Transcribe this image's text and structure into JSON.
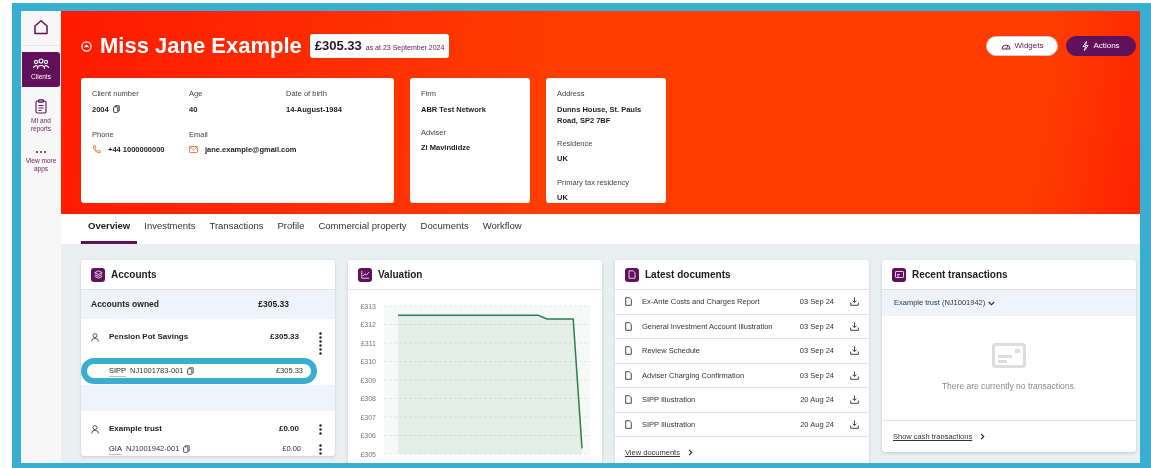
{
  "sidebar": {
    "items": [
      {
        "kind": "home",
        "selected": false
      },
      {
        "kind": "people",
        "label": "Clients",
        "selected": true
      },
      {
        "kind": "clipboard",
        "label": "MI and reports",
        "selected": false
      },
      {
        "kind": "more",
        "label": "View more apps",
        "selected": false
      }
    ]
  },
  "header": {
    "client_name": "Miss Jane Example",
    "balance": "£305.33",
    "as_at": "as at 23 September 2024",
    "buttons": [
      {
        "kind": "widgets",
        "label": "Widgets"
      },
      {
        "kind": "actions",
        "label": "Actions"
      }
    ],
    "cards": [
      {
        "fields": [
          {
            "label": "Client number",
            "value": "2004",
            "kind": "copyable"
          },
          {
            "label": "Age",
            "value": "40"
          },
          {
            "label": "Date of birth",
            "value": "14-August-1984"
          },
          {
            "label": "Phone",
            "value": "+44 1000000000",
            "kind": "phone"
          },
          {
            "label": "Email",
            "value": "jane.example@gmail.com",
            "kind": "email"
          }
        ]
      },
      {
        "fields": [
          {
            "label": "Firm",
            "value": "ABR Test Network"
          },
          {
            "label": "Adviser",
            "value": "Zi Mavindidze"
          }
        ]
      },
      {
        "fields": [
          {
            "label": "Address",
            "value": "Dunns House, St. Pauls Road, SP2 7BF"
          },
          {
            "label": "Residence",
            "value": "UK"
          },
          {
            "label": "Primary tax residency",
            "value": "UK"
          }
        ]
      }
    ]
  },
  "tabs": [
    {
      "label": "Overview",
      "selected": true
    },
    {
      "label": "Investments",
      "selected": false
    },
    {
      "label": "Transactions",
      "selected": false
    },
    {
      "label": "Profile",
      "selected": false
    },
    {
      "label": "Commercial property",
      "selected": false
    },
    {
      "label": "Documents",
      "selected": false
    },
    {
      "label": "Workflow",
      "selected": false
    }
  ],
  "accounts": {
    "title": "Accounts",
    "owned_label": "Accounts owned",
    "owned_total": "£305.33",
    "groups": [
      {
        "name": "Pension Pot Savings",
        "total": "£305.33",
        "accounts": [
          {
            "type": "SIPP",
            "number": "NJ1001783-001",
            "value": "£305.33",
            "highlighted": true
          }
        ]
      },
      {
        "name": "Example trust",
        "total": "£0.00",
        "accounts": [
          {
            "type": "GIA",
            "number": "NJ1001942-001",
            "value": "£0.00",
            "highlighted": false
          }
        ]
      }
    ]
  },
  "valuation": {
    "title": "Valuation",
    "chart_data": {
      "type": "area",
      "yticks": [
        {
          "value": 305,
          "label": "£305"
        },
        {
          "value": 306,
          "label": "£306"
        },
        {
          "value": 307,
          "label": "£307"
        },
        {
          "value": 308,
          "label": "£308"
        },
        {
          "value": 309,
          "label": "£309"
        },
        {
          "value": 310,
          "label": "£310"
        },
        {
          "value": 311,
          "label": "£311"
        },
        {
          "value": 312,
          "label": "£312"
        },
        {
          "value": 313,
          "label": "£313"
        }
      ],
      "ylim": [
        305,
        313
      ],
      "grid": true,
      "series": [
        {
          "color": "#2e7d4f",
          "values": [
            312.5,
            312.5,
            312.5,
            312.5,
            312.5,
            312.5,
            312.5,
            312.5,
            312.5,
            312.5,
            312.5,
            312.5,
            312.5,
            312.5,
            312.5,
            312.5,
            312.5,
            312.3,
            312.3,
            312.3,
            312.3,
            305.3
          ]
        }
      ]
    }
  },
  "documents": {
    "title": "Latest documents",
    "items": [
      {
        "name": "Ex-Ante Costs and Charges Report",
        "date": "03 Sep 24"
      },
      {
        "name": "General Investment Account Illustration",
        "date": "03 Sep 24"
      },
      {
        "name": "Review Schedule",
        "date": "03 Sep 24"
      },
      {
        "name": "Adviser Charging Confirmation",
        "date": "03 Sep 24"
      },
      {
        "name": "SIPP Illustration",
        "date": "20 Aug 24"
      },
      {
        "name": "SIPP Illustration",
        "date": "20 Aug 24"
      }
    ],
    "link": "View documents"
  },
  "transactions": {
    "title": "Recent transactions",
    "account": "Example trust (NJ1001942)",
    "empty_message": "There are currently no transactions.",
    "link": "Show cash transactions"
  }
}
